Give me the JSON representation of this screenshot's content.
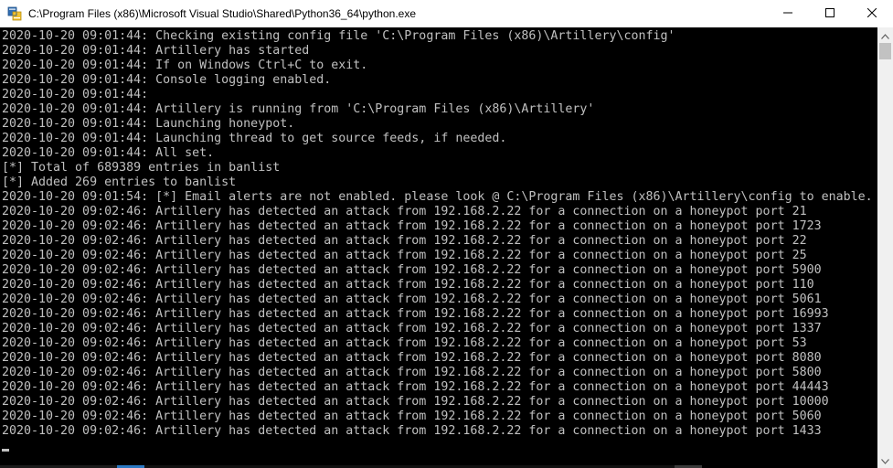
{
  "window": {
    "title": "C:\\Program Files (x86)\\Microsoft Visual Studio\\Shared\\Python36_64\\python.exe",
    "icon": "python-console-icon",
    "controls": {
      "minimize_icon": "minimize-icon",
      "maximize_icon": "maximize-icon",
      "close_icon": "close-icon"
    }
  },
  "colors": {
    "console_bg": "#000000",
    "console_text": "#c0c0c0",
    "titlebar_bg": "#ffffff",
    "scrollbar_bg": "#f0f0f0"
  },
  "console": {
    "lines": [
      "2020-10-20 09:01:44: Checking existing config file 'C:\\Program Files (x86)\\Artillery\\config'",
      "2020-10-20 09:01:44: Artillery has started",
      "2020-10-20 09:01:44: If on Windows Ctrl+C to exit.",
      "2020-10-20 09:01:44: Console logging enabled.",
      "2020-10-20 09:01:44:",
      "2020-10-20 09:01:44: Artillery is running from 'C:\\Program Files (x86)\\Artillery'",
      "2020-10-20 09:01:44: Launching honeypot.",
      "2020-10-20 09:01:44: Launching thread to get source feeds, if needed.",
      "2020-10-20 09:01:44: All set.",
      "[*] Total of 689389 entries in banlist",
      "[*] Added 269 entries to banlist",
      "2020-10-20 09:01:54: [*] Email alerts are not enabled. please look @ C:\\Program Files (x86)\\Artillery\\config to enable.",
      "2020-10-20 09:02:46: Artillery has detected an attack from 192.168.2.22 for a connection on a honeypot port 21",
      "2020-10-20 09:02:46: Artillery has detected an attack from 192.168.2.22 for a connection on a honeypot port 1723",
      "2020-10-20 09:02:46: Artillery has detected an attack from 192.168.2.22 for a connection on a honeypot port 22",
      "2020-10-20 09:02:46: Artillery has detected an attack from 192.168.2.22 for a connection on a honeypot port 25",
      "2020-10-20 09:02:46: Artillery has detected an attack from 192.168.2.22 for a connection on a honeypot port 5900",
      "2020-10-20 09:02:46: Artillery has detected an attack from 192.168.2.22 for a connection on a honeypot port 110",
      "2020-10-20 09:02:46: Artillery has detected an attack from 192.168.2.22 for a connection on a honeypot port 5061",
      "2020-10-20 09:02:46: Artillery has detected an attack from 192.168.2.22 for a connection on a honeypot port 16993",
      "2020-10-20 09:02:46: Artillery has detected an attack from 192.168.2.22 for a connection on a honeypot port 1337",
      "2020-10-20 09:02:46: Artillery has detected an attack from 192.168.2.22 for a connection on a honeypot port 53",
      "2020-10-20 09:02:46: Artillery has detected an attack from 192.168.2.22 for a connection on a honeypot port 8080",
      "2020-10-20 09:02:46: Artillery has detected an attack from 192.168.2.22 for a connection on a honeypot port 5800",
      "2020-10-20 09:02:46: Artillery has detected an attack from 192.168.2.22 for a connection on a honeypot port 44443",
      "2020-10-20 09:02:46: Artillery has detected an attack from 192.168.2.22 for a connection on a honeypot port 10000",
      "2020-10-20 09:02:46: Artillery has detected an attack from 192.168.2.22 for a connection on a honeypot port 5060",
      "2020-10-20 09:02:46: Artillery has detected an attack from 192.168.2.22 for a connection on a honeypot port 1433"
    ],
    "cursor_icon": "text-cursor"
  },
  "scrollbar": {
    "up_icon": "scroll-up-arrow-icon",
    "down_icon": "scroll-down-arrow-icon"
  }
}
